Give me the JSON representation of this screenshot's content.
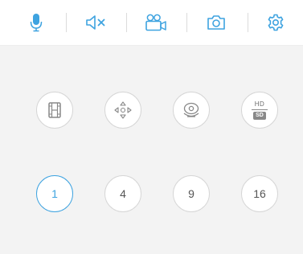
{
  "colors": {
    "accent": "#3ea3e0",
    "panel_background": "#f3f3f3"
  },
  "toolbar": {
    "buttons": [
      {
        "name": "microphone",
        "icon": "microphone-icon"
      },
      {
        "name": "mute",
        "icon": "speaker-muted-icon"
      },
      {
        "name": "record",
        "icon": "video-camera-icon"
      },
      {
        "name": "snapshot",
        "icon": "camera-icon"
      },
      {
        "name": "settings",
        "icon": "gear-icon"
      }
    ]
  },
  "controls": {
    "row1": [
      {
        "name": "playback",
        "icon": "film-strip-icon"
      },
      {
        "name": "ptz",
        "icon": "directional-pad-icon"
      },
      {
        "name": "camera-view",
        "icon": "webcam-icon"
      },
      {
        "name": "quality",
        "icon": "hd-sd-icon",
        "top_label": "HD",
        "bottom_label": "SD"
      }
    ],
    "split_options": [
      {
        "label": "1",
        "selected": true
      },
      {
        "label": "4",
        "selected": false
      },
      {
        "label": "9",
        "selected": false
      },
      {
        "label": "16",
        "selected": false
      }
    ]
  }
}
